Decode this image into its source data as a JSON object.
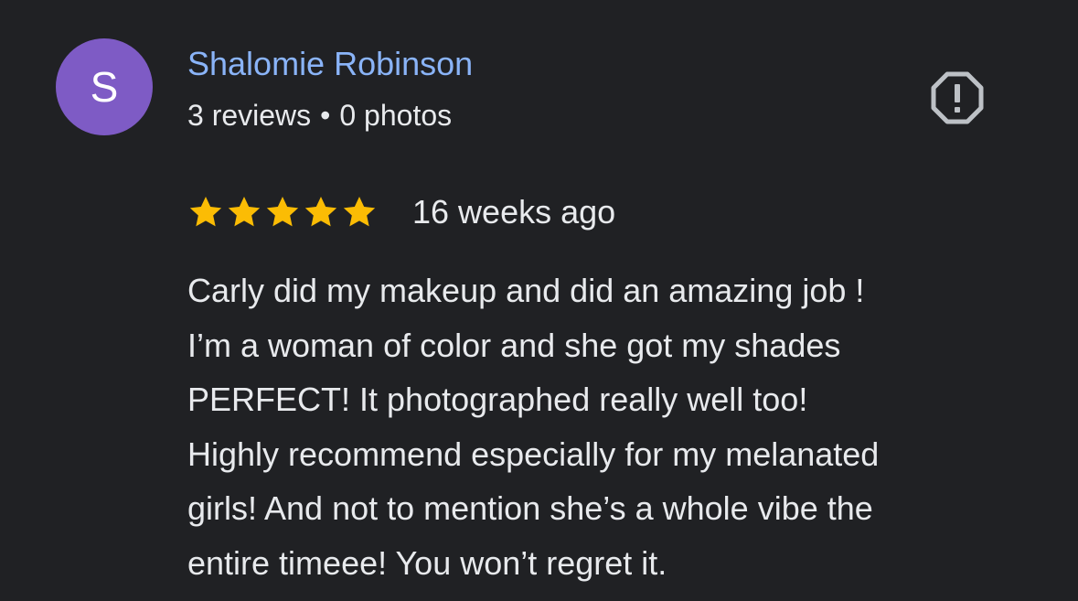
{
  "reviewer": {
    "initial": "S",
    "name": "Shalomie Robinson",
    "reviews": "3 reviews",
    "separator": "•",
    "photos": "0 photos",
    "avatar_color": "#7E5BC5"
  },
  "report": {
    "icon": "report-flag-icon"
  },
  "rating": {
    "stars": 5,
    "max_stars": 5,
    "star_color": "#FBBC04",
    "date": "16 weeks ago"
  },
  "review": {
    "lines": [
      "Carly did my makeup and did an amazing job !",
      "I’m a woman of color and she got my shades",
      "PERFECT! It photographed really well too!",
      "Highly recommend especially for my melanated",
      "girls! And not to mention she’s a whole vibe the",
      "entire timeee! You won’t regret it."
    ]
  },
  "colors": {
    "background": "#202124",
    "name": "#8AB4F8",
    "text": "#E8EAED",
    "icon": "#BDC1C6"
  }
}
